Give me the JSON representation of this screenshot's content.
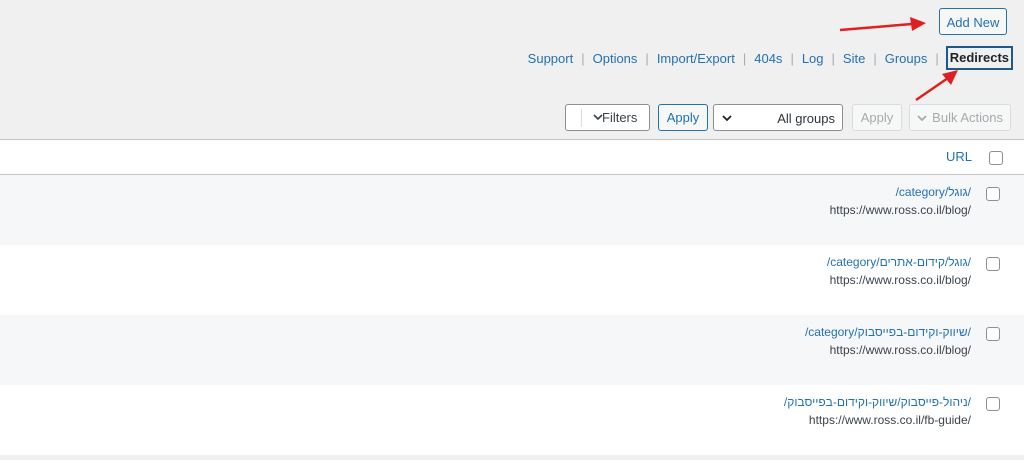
{
  "header": {
    "add_new_label": "Add New"
  },
  "subnav": {
    "items": [
      "Support",
      "Options",
      "Import/Export",
      "404s",
      "Log",
      "Site",
      "Groups"
    ],
    "current": "Redirects",
    "separator": "|"
  },
  "toolbar": {
    "filters_label": "Filters",
    "apply_label": "Apply",
    "groups_value": "All groups",
    "apply_disabled_label": "Apply",
    "bulk_actions_label": "Bulk Actions"
  },
  "table": {
    "url_header": "URL",
    "rows": [
      {
        "source": "/category/גוגל/",
        "target": "https://www.ross.co.il/blog/"
      },
      {
        "source": "/category/גוגל/קידום-אתרים/",
        "target": "https://www.ross.co.il/blog/"
      },
      {
        "source": "/category/שיווק-וקידום-בפייסבוק/",
        "target": "https://www.ross.co.il/blog/"
      },
      {
        "source": "/ניהול-פייסבוק/שיווק-וקידום-בפייסבוק/",
        "target": "https://www.ross.co.il/fb-guide/"
      }
    ]
  },
  "colors": {
    "accent": "#2271b1",
    "annotation_arrow": "#e02020"
  }
}
